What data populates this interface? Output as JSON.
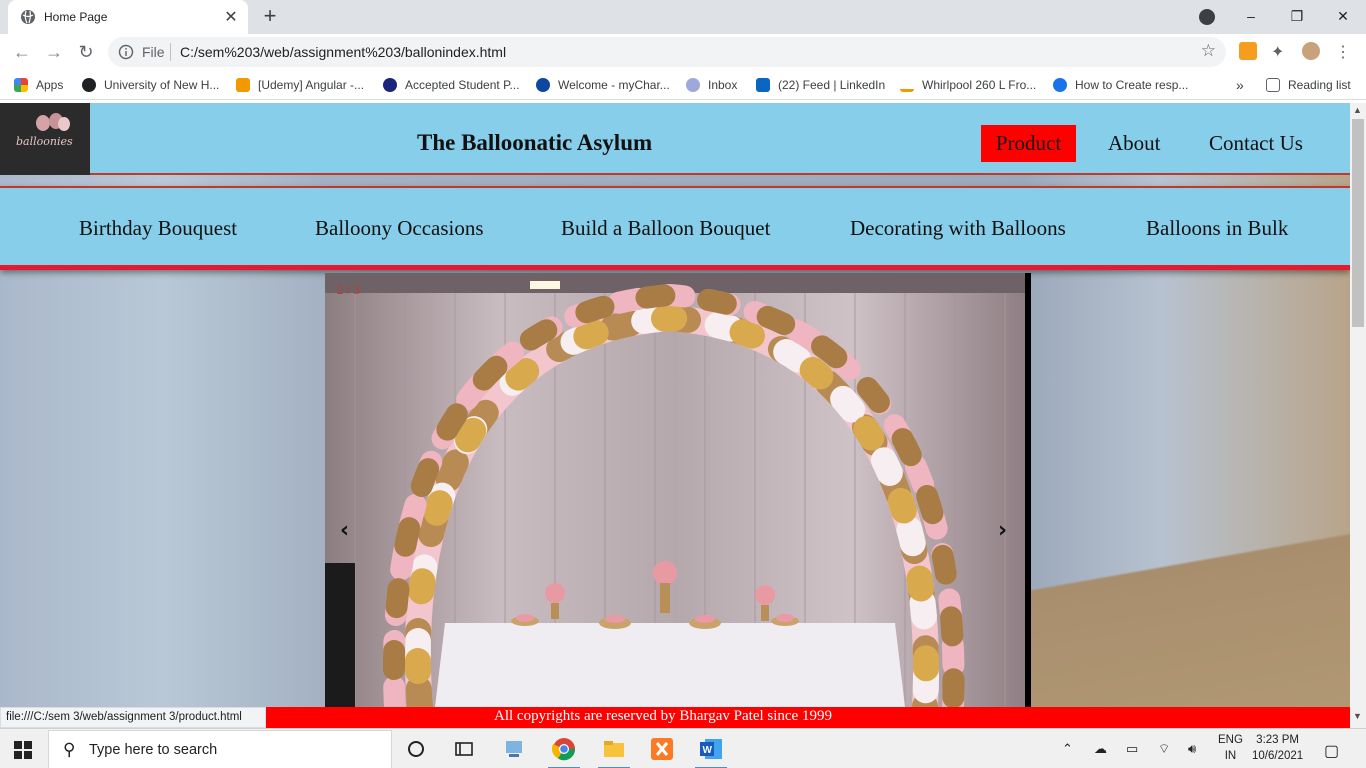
{
  "browser": {
    "tab_title": "Home Page",
    "new_tab": "+",
    "address_file_label": "File",
    "address_url": "C:/sem%203/web/assignment%203/ballonindex.html",
    "window_minimize": "–",
    "window_restore": "❐",
    "window_close": "✕",
    "bookmarks": [
      {
        "label": "Apps",
        "color": "#ea4335"
      },
      {
        "label": "University of New H...",
        "color": "#202124"
      },
      {
        "label": "[Udemy] Angular -...",
        "color": "#f29900"
      },
      {
        "label": "Accepted Student P...",
        "color": "#1a237e"
      },
      {
        "label": "Welcome - myChar...",
        "color": "#0d47a1"
      },
      {
        "label": "Inbox",
        "color": "#9fa8da"
      },
      {
        "label": "(22) Feed | LinkedIn",
        "color": "#0a66c2"
      },
      {
        "label": "Whirlpool 260 L Fro...",
        "color": "#111111"
      },
      {
        "label": "How to Create resp...",
        "color": "#1a73e8"
      }
    ],
    "bookmarks_more": "»",
    "reading_list": "Reading list",
    "status_url": "file:///C:/sem 3/web/assignment 3/product.html"
  },
  "site": {
    "title": "The Balloonatic Asylum",
    "logo_text": "balloonies",
    "nav": [
      "Product",
      "About",
      "Contact Us"
    ],
    "active_nav": "Product",
    "subnav": [
      "Birthday Bouquest",
      "Balloony Occasions",
      "Build a Balloon Bouquet",
      "Decorating with Balloons",
      "Balloons in Bulk"
    ],
    "slideshow": {
      "counter": "2 / 3",
      "prev": "‹",
      "next": "›"
    },
    "footer": "All copyrights are reserved by Bhargav Patel since 1999",
    "colors": {
      "header_bg": "#87ceeb",
      "accent": "#ff0000",
      "border": "#c0392b"
    }
  },
  "taskbar": {
    "search_placeholder": "Type here to search",
    "lang_top": "ENG",
    "lang_bottom": "IN",
    "time": "3:23 PM",
    "date": "10/6/2021",
    "apps": [
      "cortana-icon",
      "task-view-icon",
      "network-pc-icon",
      "chrome-icon",
      "file-explorer-icon",
      "xampp-icon",
      "word-icon"
    ]
  }
}
